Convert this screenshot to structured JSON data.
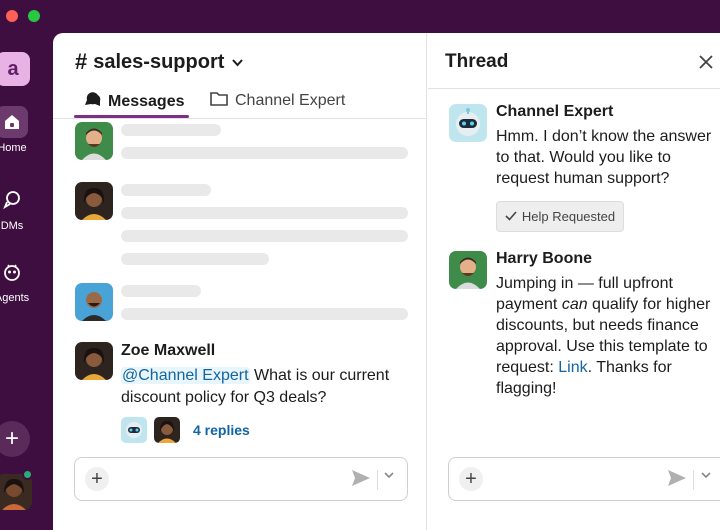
{
  "rail": {
    "workspace_initial": "a",
    "home_label": "Home",
    "dms_label": "DMs",
    "agents_label": "Agents",
    "add_label": "+"
  },
  "channel": {
    "hash": "#",
    "name": "sales-support",
    "tabs": [
      {
        "label": "Messages",
        "icon": "chat-bubbles-icon",
        "active": true
      },
      {
        "label": "Channel Expert",
        "icon": "folder-icon",
        "active": false
      }
    ],
    "message": {
      "author": "Zoe Maxwell",
      "mention": "@Channel Expert",
      "text": " What is our current discount policy for Q3 deals?",
      "replies": "4 replies"
    }
  },
  "thread": {
    "title": "Thread",
    "close_icon": "close-icon",
    "messages": [
      {
        "author": "Channel Expert",
        "text": "Hmm. I don’t know the answer to that. Would you like to request human support?",
        "button": "Help Requested"
      },
      {
        "author": "Harry Boone",
        "text_1": "Jumping in — full upfront payment ",
        "emphasis": "can",
        "text_2": " qualify for higher discounts, but needs finance approval. Use this template to request: ",
        "link": "Link",
        "text_3": ". Thanks for flagging!"
      }
    ]
  },
  "colors": {
    "aubergine": "#3f0e40",
    "accent": "#7c3085",
    "link": "#1264a3",
    "presence": "#2bac76"
  }
}
